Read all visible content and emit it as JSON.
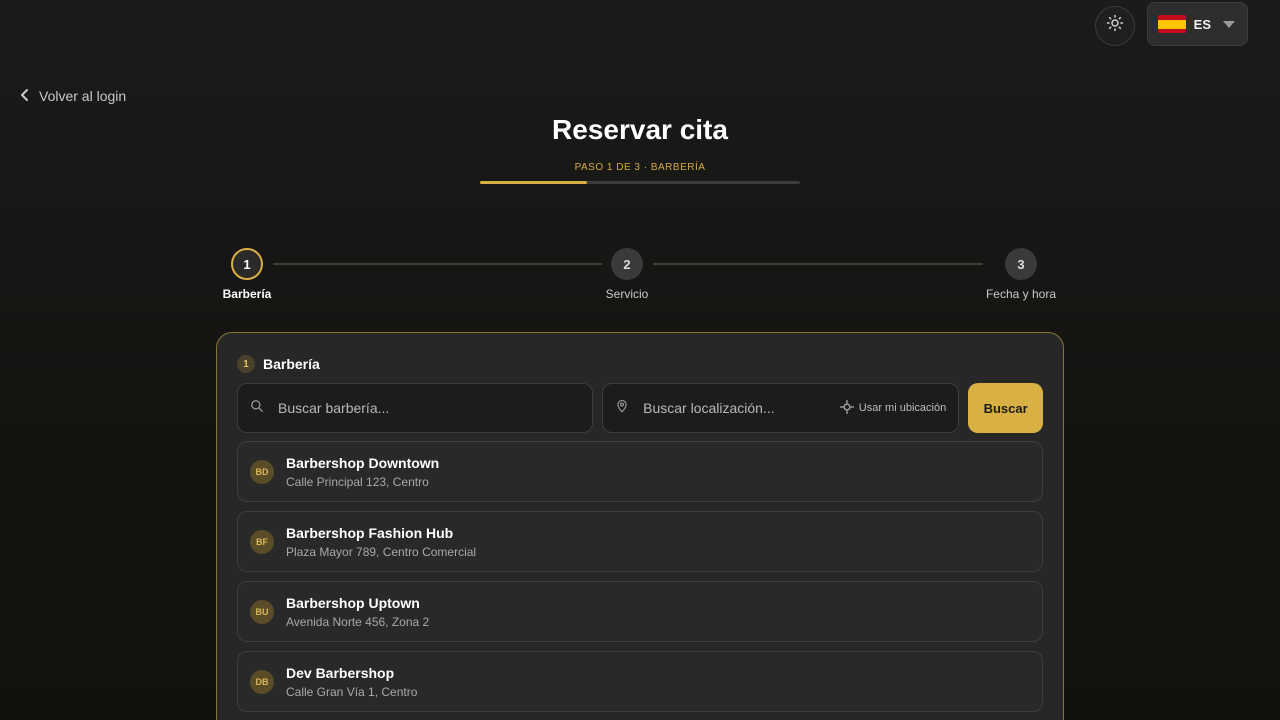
{
  "header": {
    "language_code": "ES",
    "back_label": "Volver al login"
  },
  "page": {
    "title": "Reservar cita",
    "step_caption": "PASO 1 DE 3 · BARBERÍA",
    "progress_fraction": 0.333
  },
  "stepper": {
    "steps": [
      {
        "number": "1",
        "label": "Barbería",
        "active": true
      },
      {
        "number": "2",
        "label": "Servicio",
        "active": false
      },
      {
        "number": "3",
        "label": "Fecha y hora",
        "active": false
      }
    ]
  },
  "card": {
    "badge": "1",
    "title": "Barbería",
    "search_name_placeholder": "Buscar barbería...",
    "search_location_placeholder": "Buscar localización...",
    "use_location_label": "Usar mi ubicación",
    "search_button_label": "Buscar",
    "results": [
      {
        "initials": "BD",
        "name": "Barbershop Downtown",
        "address": "Calle Principal 123, Centro"
      },
      {
        "initials": "BF",
        "name": "Barbershop Fashion Hub",
        "address": "Plaza Mayor 789, Centro Comercial"
      },
      {
        "initials": "BU",
        "name": "Barbershop Uptown",
        "address": "Avenida Norte 456, Zona 2"
      },
      {
        "initials": "DB",
        "name": "Dev Barbershop",
        "address": "Calle Gran Vía 1, Centro"
      }
    ]
  },
  "colors": {
    "accent": "#d8b043",
    "background": "#141414",
    "card": "#272727"
  },
  "icons": {
    "theme": "sun-icon",
    "flag": "spain-flag-icon",
    "back": "chevron-left-icon",
    "search": "search-icon",
    "location": "map-pin-icon",
    "locate": "crosshair-icon"
  }
}
